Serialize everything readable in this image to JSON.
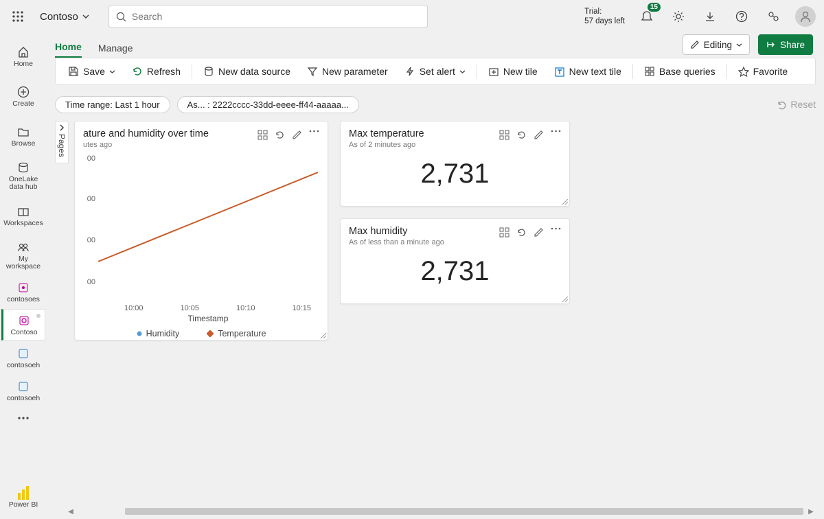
{
  "header": {
    "workspace": "Contoso",
    "search_placeholder": "Search",
    "trial_label": "Trial:",
    "trial_value": "57 days left",
    "notification_badge": "15"
  },
  "rail": {
    "home": "Home",
    "create": "Create",
    "browse": "Browse",
    "onelake": "OneLake data hub",
    "workspaces": "Workspaces",
    "myws": "My workspace",
    "contosoes": "contosoes",
    "contoso": "Contoso",
    "contosoeh1": "contosoeh",
    "contosoeh2": "contosoeh",
    "powerbi": "Power BI"
  },
  "tabs": {
    "home": "Home",
    "manage": "Manage",
    "editing": "Editing",
    "share": "Share"
  },
  "toolbar": {
    "save": "Save",
    "refresh": "Refresh",
    "newds": "New data source",
    "newparam": "New parameter",
    "setalert": "Set alert",
    "newtile": "New tile",
    "newtext": "New text tile",
    "basequeries": "Base queries",
    "favorite": "Favorite"
  },
  "filters": {
    "timerange": "Time range: Last 1 hour",
    "as": "As... : 2222cccc-33dd-eeee-ff44-aaaaa...",
    "reset": "Reset"
  },
  "pages": {
    "label": "Pages"
  },
  "tile_chart": {
    "title": "ature and humidity over time",
    "subtitle": "utes ago"
  },
  "tile_maxtemp": {
    "title": "Max temperature",
    "subtitle": "As of 2 minutes ago",
    "value": "2,731"
  },
  "tile_maxhum": {
    "title": "Max humidity",
    "subtitle": "As of less than a minute ago",
    "value": "2,731"
  },
  "legend": {
    "humidity": "Humidity",
    "temperature": "Temperature"
  },
  "chart_data": {
    "type": "line",
    "xlabel": "Timestamp",
    "ylabel": "",
    "categories": [
      "10:00",
      "10:05",
      "10:10",
      "10:15"
    ],
    "y_ticks": [
      "00",
      "00",
      "00",
      "00"
    ],
    "series": [
      {
        "name": "Temperature",
        "color": "#c85d2c",
        "values": null,
        "trend": "linear_increasing"
      },
      {
        "name": "Humidity",
        "color": "#5b9bd5",
        "values": null
      }
    ]
  }
}
